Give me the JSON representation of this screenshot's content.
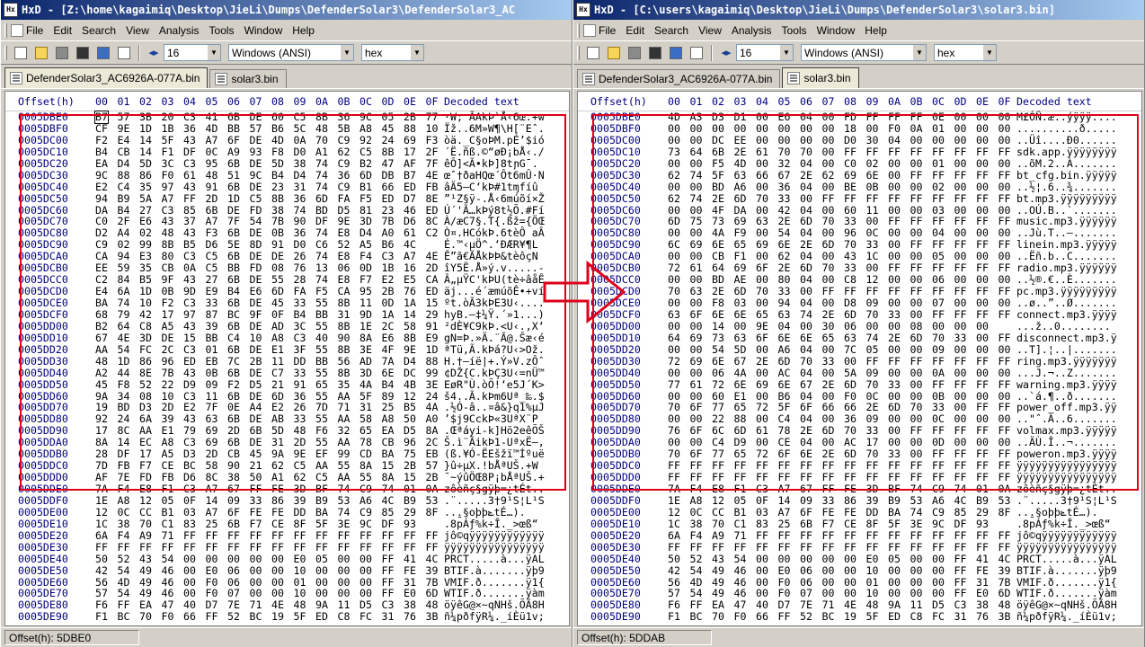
{
  "windows": [
    {
      "id": "left",
      "title": "HxD - [Z:\\home\\kagaimiq\\Desktop\\JieLi\\Dumps\\DefenderSolar3\\DefenderSolar3_AC",
      "menu": [
        "File",
        "Edit",
        "Search",
        "View",
        "Analysis",
        "Tools",
        "Window",
        "Help"
      ],
      "toolbar": {
        "columns": "16",
        "charset": "Windows (ANSI)",
        "mode": "hex"
      },
      "tabs": [
        {
          "label": "DefenderSolar3_AC6926A-077A.bin",
          "active": true
        },
        {
          "label": "solar3.bin",
          "active": false
        }
      ],
      "header": {
        "offset": "Offset(h)",
        "cols": [
          "00",
          "01",
          "02",
          "03",
          "04",
          "05",
          "06",
          "07",
          "08",
          "09",
          "0A",
          "0B",
          "0C",
          "0D",
          "0E",
          "0F"
        ],
        "decoded": "Decoded text"
      },
      "status": "Offset(h): 5DBE0",
      "rows": [
        {
          "o": "0005DBE0",
          "h": "B7 57 3B 20 C3 41 6B DE 60 C5 8B 36 9C 05 2B 77",
          "d": "·W; ÃAkÞ`Å‹6œ.+w"
        },
        {
          "o": "0005DBF0",
          "h": "CF 9E 1D 1B 36 4D BB 57 B6 5C 48 5B A8 45 88 10",
          "d": "Ïž..6M»W¶\\H[¨Eˆ."
        },
        {
          "o": "0005DC00",
          "h": "F2 E4 14 5F 43 A7 6F DE 4D 0A 70 C9 92 24 69 F3",
          "d": "òä._C§oÞM.pÉ’$ió"
        },
        {
          "o": "0005DC10",
          "h": "B4 CB 14 F1 DF 0C A9 93 F8 D0 A1 62 C5 8B 17 2F",
          "d": "´Ë.ñß.©“øÐ¡bÅ‹./"
        },
        {
          "o": "0005DC20",
          "h": "EA D4 5D 3C C3 95 6B DE 5D 38 74 C9 B2 47 AF 7F",
          "d": "êÔ]<Ã•kÞ]8tɲG¯."
        },
        {
          "o": "0005DC30",
          "h": "9C 88 86 F0 61 48 51 9C B4 D4 74 36 6D DB B7 4E",
          "d": "œˆ†ðaHQœ´Ôt6mÛ·N"
        },
        {
          "o": "0005DC40",
          "h": "E2 C4 35 97 43 91 6B DE 23 31 74 C9 B1 66 ED FB",
          "d": "âÄ5—C‘kÞ#1tɱfíû"
        },
        {
          "o": "0005DC50",
          "h": "94 B9 5A A7 FF 2D 1D C5 8B 36 6D FA F5 ED D7 8E",
          "d": "”¹Z§ÿ-.Å‹6múõí×Ž"
        },
        {
          "o": "0005DC60",
          "h": "DA B4 27 C3 85 6B DE FD 38 74 BD D5 81 23 46 ED",
          "d": "Ú´'Ã…kÞý8t½Õ.#Fí"
        },
        {
          "o": "0005DC70",
          "h": "C0 2F E6 43 37 A7 7F 54 7B 90 DF 9E 3D 7B D6 8C",
          "d": "À/æC7§.T{.ßž={ÖŒ"
        },
        {
          "o": "0005DC80",
          "h": "D2 A4 02 48 43 F3 6B DE 0B 36 74 E8 D4 A0 61 C2",
          "d": "Ò¤.HCókÞ.6tèÔ aÂ"
        },
        {
          "o": "0005DC90",
          "h": "C9 02 99 8B B5 D6 5E 8D 91 D0 C6 52 A5 B6 4C",
          "d": "É.™‹µÖ^.‘ÐÆR¥¶L"
        },
        {
          "o": "0005DCA0",
          "h": "CA 94 E3 80 C3 C5 6B DE DE 26 74 E8 F4 C3 A7 4E",
          "d": "Ê”ã€ÃÅkÞÞ&tèôçN"
        },
        {
          "o": "0005DCB0",
          "h": "EE 59 35 CB 0A C5 BB FD 08 76 13 06 0D 1B 16 2D",
          "d": "îY5Ë.Å»ý.v.....-"
        },
        {
          "o": "0005DCC0",
          "h": "C2 84 B5 9F 43 27 6B DE 55 28 74 E8 F7 E2 E5 CA",
          "d": "Â„µŸC'kÞU(tè÷âåÊ"
        },
        {
          "o": "0005DCD0",
          "h": "E4 6A 1D 0B 9D E9 B4 E6 6D FA F5 CA 95 2B 76 ED",
          "d": "äj...é´æmúõÊ•+ví"
        },
        {
          "o": "0005DCE0",
          "h": "BA 74 10 F2 C3 33 6B DE 45 33 55 8B 11 0D 1A 15",
          "d": "ºt.òÃ3kÞE3U‹...."
        },
        {
          "o": "0005DCF0",
          "h": "68 79 42 17 97 87 BC 9F 0F B4 BB 31 9D 1A 14 29",
          "d": "hyB.—‡¼Ÿ.´»1...)"
        },
        {
          "o": "0005DD00",
          "h": "B2 64 C8 A5 43 39 6B DE AD 3C 55 8B 1E 2C 58 91",
          "d": "²dÈ¥C9kÞ.<U‹.,X‘"
        },
        {
          "o": "0005DD10",
          "h": "67 4E 3D DE 15 BB C4 10 A8 C3 40 90 8A E6 8B E9",
          "d": "gN=Þ.»Ä.¨Ã@.Šæ‹é"
        },
        {
          "o": "0005DD20",
          "h": "AA 54 FC 2C C3 01 6B DE E1 3F 55 8B 3E 4F 9E 1D",
          "d": "ªTü,Ã.kÞá?U‹>Ož."
        },
        {
          "o": "0005DD30",
          "h": "48 1D 86 96 ED EB 7C 2B 11 DD BB 56 AD 7A D4 88",
          "d": "H.†–íë|+.Ý»V.zÔˆ"
        },
        {
          "o": "0005DD40",
          "h": "A2 44 8E 7B 43 0B 6B DE C7 33 55 8B 3D 6E DC 99",
          "d": "¢DŽ{C.kÞÇ3U‹=nÜ™"
        },
        {
          "o": "0005DD50",
          "h": "45 F8 52 22 D9 09 F2 D5 21 91 65 35 4A B4 4B 3E",
          "d": "EøR\"Ù.òÕ!‘e5J´K>"
        },
        {
          "o": "0005DD60",
          "h": "9A 34 08 10 C3 11 6B DE 6D 36 55 AA 5F 89 12 24",
          "d": "š4..Ã.kÞm6Uª_‰.$"
        },
        {
          "o": "0005DD70",
          "h": "19 BD D3 2D E2 7F 0E A4 E2 26 7D 71 31 25 B5 4A",
          "d": ".½Ó-â..¤â&}q1%µJ"
        },
        {
          "o": "0005DD80",
          "h": "92 24 6A 39 43 63 6B DE AB 33 55 AA 58 A8 50 A0",
          "d": "’$j9CckÞ«3UªX¨P "
        },
        {
          "o": "0005DD90",
          "h": "17 8C AA E1 79 69 2D 6B 5D 48 F6 32 65 EA D5 8A",
          "d": ".Œªáyi-k]Hö2eêÕŠ"
        },
        {
          "o": "0005DDA0",
          "h": "8A 14 EC A8 C3 69 6B DE 31 2D 55 AA 78 CB 96 2C",
          "d": "Š.ì¨ÃikÞ1-UªxË–,"
        },
        {
          "o": "0005DDB0",
          "h": "28 DF 17 A5 D3 2D CB 45 9A 9E EF 99 CD BA 75 EB",
          "d": "(ß.¥Ó-ËEšžï™Íºuë"
        },
        {
          "o": "0005DDC0",
          "h": "7D FB F7 CE BC 58 90 21 62 C5 AA 55 8A 15 2B 57",
          "d": "}û÷μX.!bÅªUŠ.+W"
        },
        {
          "o": "0005DDD0",
          "h": "AF 7E FD FB D6 8C 38 50 A1 62 C5 AA 55 8A 15 2B",
          "d": "¯~ýûÖŒ8P¡bÅªUŠ.+"
        },
        {
          "o": "0005DDE0",
          "h": "7A F4 E8 F1 C3 A7 67 FF FE 3D BF 74 C9 74 01 0A",
          "d": "zôèñç§gÿþ=¿tÉt.."
        },
        {
          "o": "0005DDF0",
          "h": "1E A8 12 05 0F 14 09 33 86 39 B9 53 A6 4C B9 53",
          "d": ".¨.....3†9¹S¦L¹S"
        },
        {
          "o": "0005DE00",
          "h": "12 0C CC B1 03 A7 6F FE FE DD BA 74 C9 85 29 8F",
          "d": "..̱.§oþþݺtÉ…)."
        },
        {
          "o": "0005DE10",
          "h": "1C 38 70 C1 83 25 6B F7 CE 8F 5F 3E 9C DF 93",
          "d": ".8pÁƒ%k÷Î._>œß“"
        },
        {
          "o": "0005DE20",
          "h": "6A F4 A9 71 FF FF FF FF FF FF FF FF FF FF FF FF",
          "d": "jô©qÿÿÿÿÿÿÿÿÿÿÿÿ"
        },
        {
          "o": "0005DE30",
          "h": "FF FF FF FF FF FF FF FF FF FF FF FF FF FF FF FF",
          "d": "ÿÿÿÿÿÿÿÿÿÿÿÿÿÿÿÿ"
        },
        {
          "o": "0005DE40",
          "h": "50 52 43 54 00 00 00 00 00 E0 05 00 00 FF 41 4C",
          "d": "PRCT.....à...ÿAL"
        },
        {
          "o": "0005DE50",
          "h": "42 54 49 46 00 E0 06 00 00 10 00 00 00 FF FE 39",
          "d": "BTIF.à.......ÿþ9"
        },
        {
          "o": "0005DE60",
          "h": "56 4D 49 46 00 F0 06 00 00 01 00 00 00 FF 31 7B",
          "d": "VMIF.ð.......ÿ1{"
        },
        {
          "o": "0005DE70",
          "h": "57 54 49 46 00 F0 07 00 00 10 00 00 00 FF E0 6D",
          "d": "WTIF.ð.......ÿàm"
        },
        {
          "o": "0005DE80",
          "h": "F6 FF EA 47 40 D7 7E 71 4E 48 9A 11 D5 C3 38 48",
          "d": "öÿêG@×~qNHš.ÕÃ8H"
        },
        {
          "o": "0005DE90",
          "h": "F1 BC 70 F0 66 FF 52 BC 19 5F ED C8 FC 31 76 3B",
          "d": "ñ¼pðfÿR¼._íÈü1v;"
        }
      ]
    },
    {
      "id": "right",
      "title": "HxD - [C:\\users\\kagaimiq\\Desktop\\JieLi\\Dumps\\DefenderSolar3\\solar3.bin]",
      "menu": [
        "File",
        "Edit",
        "Search",
        "View",
        "Analysis",
        "Tools",
        "Window",
        "Help"
      ],
      "toolbar": {
        "columns": "16",
        "charset": "Windows (ANSI)",
        "mode": "hex"
      },
      "tabs": [
        {
          "label": "DefenderSolar3_AC6926A-077A.bin",
          "active": false
        },
        {
          "label": "solar3.bin",
          "active": true
        }
      ],
      "header": {
        "offset": "Offset(h)",
        "cols": [
          "00",
          "01",
          "02",
          "03",
          "04",
          "05",
          "06",
          "07",
          "08",
          "09",
          "0A",
          "0B",
          "0C",
          "0D",
          "0E",
          "0F"
        ],
        "decoded": "Decoded text"
      },
      "status": "Offset(h): 5DDAB",
      "rows": [
        {
          "o": "0005DBE0",
          "h": "4D A3 D3 D1 00 E6 04 00 FD FF FF FF 0E 00 00 00",
          "d": "M£ÓÑ.æ..ýÿÿÿ...."
        },
        {
          "o": "0005DBF0",
          "h": "00 00 00 00 00 00 00 00 18 00 F0 0A 01 00 00 00",
          "d": "..........ð....."
        },
        {
          "o": "0005DC00",
          "h": "00 00 DC EE 00 00 00 00 D0 30 04 00 00 00 00 00",
          "d": "..Üî....Ð0......"
        },
        {
          "o": "0005DC10",
          "h": "73 64 6B 2E 61 70 70 00 FF FF FF FF FF FF FF FF",
          "d": "sdk.app.ÿÿÿÿÿÿÿÿ"
        },
        {
          "o": "0005DC20",
          "h": "00 00 F5 4D 00 32 04 00 C0 02 00 00 01 00 00 00",
          "d": "..õM.2..À......."
        },
        {
          "o": "0005DC30",
          "h": "62 74 5F 63 66 67 2E 62 69 6E 00 FF FF FF FF FF",
          "d": "bt_cfg.bin.ÿÿÿÿÿ"
        },
        {
          "o": "0005DC40",
          "h": "00 00 BD A6 00 36 04 00 BE 0B 00 00 02 00 00 00",
          "d": "..½¦.6..¾......."
        },
        {
          "o": "0005DC50",
          "h": "62 74 2E 6D 70 33 00 FF FF FF FF FF FF FF FF FF",
          "d": "bt.mp3.ÿÿÿÿÿÿÿÿÿ"
        },
        {
          "o": "0005DC60",
          "h": "00 00 4F DA 00 42 04 00 60 11 00 00 03 00 00 00",
          "d": "..OÚ.B..`......."
        },
        {
          "o": "0005DC70",
          "h": "6D 75 73 69 63 2E 6D 70 33 00 FF FF FF FF FF FF",
          "d": "music.mp3.ÿÿÿÿÿÿ"
        },
        {
          "o": "0005DC80",
          "h": "00 00 4A F9 00 54 04 00 96 0C 00 00 04 00 00 00",
          "d": "..Jù.T..–......."
        },
        {
          "o": "0005DC90",
          "h": "6C 69 6E 65 69 6E 2E 6D 70 33 00 FF FF FF FF FF",
          "d": "linein.mp3.ÿÿÿÿÿ"
        },
        {
          "o": "0005DCA0",
          "h": "00 00 CB F1 00 62 04 00 43 1C 00 00 05 00 00 00",
          "d": "..Ëñ.b..C......."
        },
        {
          "o": "0005DCB0",
          "h": "72 61 64 69 6F 2E 6D 70 33 00 FF FF FF FF FF FF",
          "d": "radio.mp3.ÿÿÿÿÿÿ"
        },
        {
          "o": "0005DCC0",
          "h": "00 00 BD AE 00 80 04 00 C8 12 00 00 06 00 00 00",
          "d": "..½®.€..È......."
        },
        {
          "o": "0005DCD0",
          "h": "70 63 2E 6D 70 33 00 FF FF FF FF FF FF FF FF FF",
          "d": "pc.mp3.ÿÿÿÿÿÿÿÿÿ"
        },
        {
          "o": "0005DCE0",
          "h": "00 00 F8 03 00 94 04 00 D8 09 00 00 07 00 00 00",
          "d": "..ø..”..Ø......."
        },
        {
          "o": "0005DCF0",
          "h": "63 6F 6E 6E 65 63 74 2E 6D 70 33 00 FF FF FF FF",
          "d": "connect.mp3.ÿÿÿÿ"
        },
        {
          "o": "0005DD00",
          "h": "00 00 14 00 9E 04 00 30 06 00 00 08 00 00 00",
          "d": "...ž..0........"
        },
        {
          "o": "0005DD10",
          "h": "64 69 73 63 6F 6E 6E 65 63 74 2E 6D 70 33 00 FF",
          "d": "disconnect.mp3.ÿ"
        },
        {
          "o": "0005DD20",
          "h": "00 00 54 5D 00 A6 04 00 7C 05 00 00 09 00 00 00",
          "d": "..T].¦..|......."
        },
        {
          "o": "0005DD30",
          "h": "72 69 6E 67 2E 6D 70 33 00 FF FF FF FF FF FF FF",
          "d": "ring.mp3.ÿÿÿÿÿÿÿ"
        },
        {
          "o": "0005DD40",
          "h": "00 00 06 4A 00 AC 04 00 5A 09 00 00 0A 00 00 00",
          "d": "...J.¬..Z......."
        },
        {
          "o": "0005DD50",
          "h": "77 61 72 6E 69 6E 67 2E 6D 70 33 00 FF FF FF FF",
          "d": "warning.mp3.ÿÿÿÿ"
        },
        {
          "o": "0005DD60",
          "h": "00 00 60 E1 00 B6 04 00 F0 0C 00 00 0B 00 00 00",
          "d": "..`á.¶..ð......."
        },
        {
          "o": "0005DD70",
          "h": "70 6F 77 65 72 5F 6F 66 66 2E 6D 70 33 00 FF FF",
          "d": "power_off.mp3.ÿÿ"
        },
        {
          "o": "0005DD80",
          "h": "00 00 22 88 00 C4 04 00 36 09 00 00 0C 00 00 00",
          "d": "..\"ˆ.Ä..6......."
        },
        {
          "o": "0005DD90",
          "h": "76 6F 6C 6D 61 78 2E 6D 70 33 00 FF FF FF FF FF",
          "d": "volmax.mp3.ÿÿÿÿÿ"
        },
        {
          "o": "0005DDA0",
          "h": "00 00 C4 D9 00 CE 04 00 AC 17 00 00 0D 00 00 00",
          "d": "..ÄÙ.Î..¬......."
        },
        {
          "o": "0005DDB0",
          "h": "70 6F 77 65 72 6F 6E 2E 6D 70 33 00 FF FF FF FF",
          "d": "poweron.mp3.ÿÿÿÿ"
        },
        {
          "o": "0005DDC0",
          "h": "FF FF FF FF FF FF FF FF FF FF FF FF FF FF FF FF",
          "d": "ÿÿÿÿÿÿÿÿÿÿÿÿÿÿÿÿ"
        },
        {
          "o": "0005DDD0",
          "h": "FF FF FF FF FF FF FF FF FF FF FF FF FF FF FF FF",
          "d": "ÿÿÿÿÿÿÿÿÿÿÿÿÿÿÿÿ"
        },
        {
          "o": "0005DDE0",
          "h": "7A F4 E8 F1 C3 A7 67 FF FE 3D BF 74 C9 74 01 0A",
          "d": "zôèñç§gÿþ=¿tÉt.."
        },
        {
          "o": "0005DDF0",
          "h": "1E A8 12 05 0F 14 09 33 86 39 B9 53 A6 4C B9 53",
          "d": ".¨.....3†9¹S¦L¹S"
        },
        {
          "o": "0005DE00",
          "h": "12 0C CC B1 03 A7 6F FE FE DD BA 74 C9 85 29 8F",
          "d": "..̱.§oþþݺtÉ…)."
        },
        {
          "o": "0005DE10",
          "h": "1C 38 70 C1 83 25 6B F7 CE 8F 5F 3E 9C DF 93",
          "d": ".8pÁƒ%k÷Î._>œß“"
        },
        {
          "o": "0005DE20",
          "h": "6A F4 A9 71 FF FF FF FF FF FF FF FF FF FF FF FF",
          "d": "jô©qÿÿÿÿÿÿÿÿÿÿÿÿ"
        },
        {
          "o": "0005DE30",
          "h": "FF FF FF FF FF FF FF FF FF FF FF FF FF FF FF FF",
          "d": "ÿÿÿÿÿÿÿÿÿÿÿÿÿÿÿÿ"
        },
        {
          "o": "0005DE40",
          "h": "50 52 43 54 00 00 00 00 00 E0 05 00 00 FF 41 4C",
          "d": "PRCT.....à...ÿAL"
        },
        {
          "o": "0005DE50",
          "h": "42 54 49 46 00 E0 06 00 00 10 00 00 00 FF FE 39",
          "d": "BTIF.à.......ÿþ9"
        },
        {
          "o": "0005DE60",
          "h": "56 4D 49 46 00 F0 06 00 00 01 00 00 00 FF 31 7B",
          "d": "VMIF.ð.......ÿ1{"
        },
        {
          "o": "0005DE70",
          "h": "57 54 49 46 00 F0 07 00 00 10 00 00 00 FF E0 6D",
          "d": "WTIF.ð.......ÿàm"
        },
        {
          "o": "0005DE80",
          "h": "F6 FF EA 47 40 D7 7E 71 4E 48 9A 11 D5 C3 38 48",
          "d": "öÿêG@×~qNHš.ÕÃ8H"
        },
        {
          "o": "0005DE90",
          "h": "F1 BC 70 F0 66 FF 52 BC 19 5F ED C8 FC 31 76 3B",
          "d": "ñ¼pðfÿR¼._íÈü1v;"
        }
      ]
    }
  ],
  "colors": {
    "highlight": "#e0001a",
    "offset_text": "#000080",
    "title_start": "#0a246a",
    "title_end": "#a6caf0"
  }
}
